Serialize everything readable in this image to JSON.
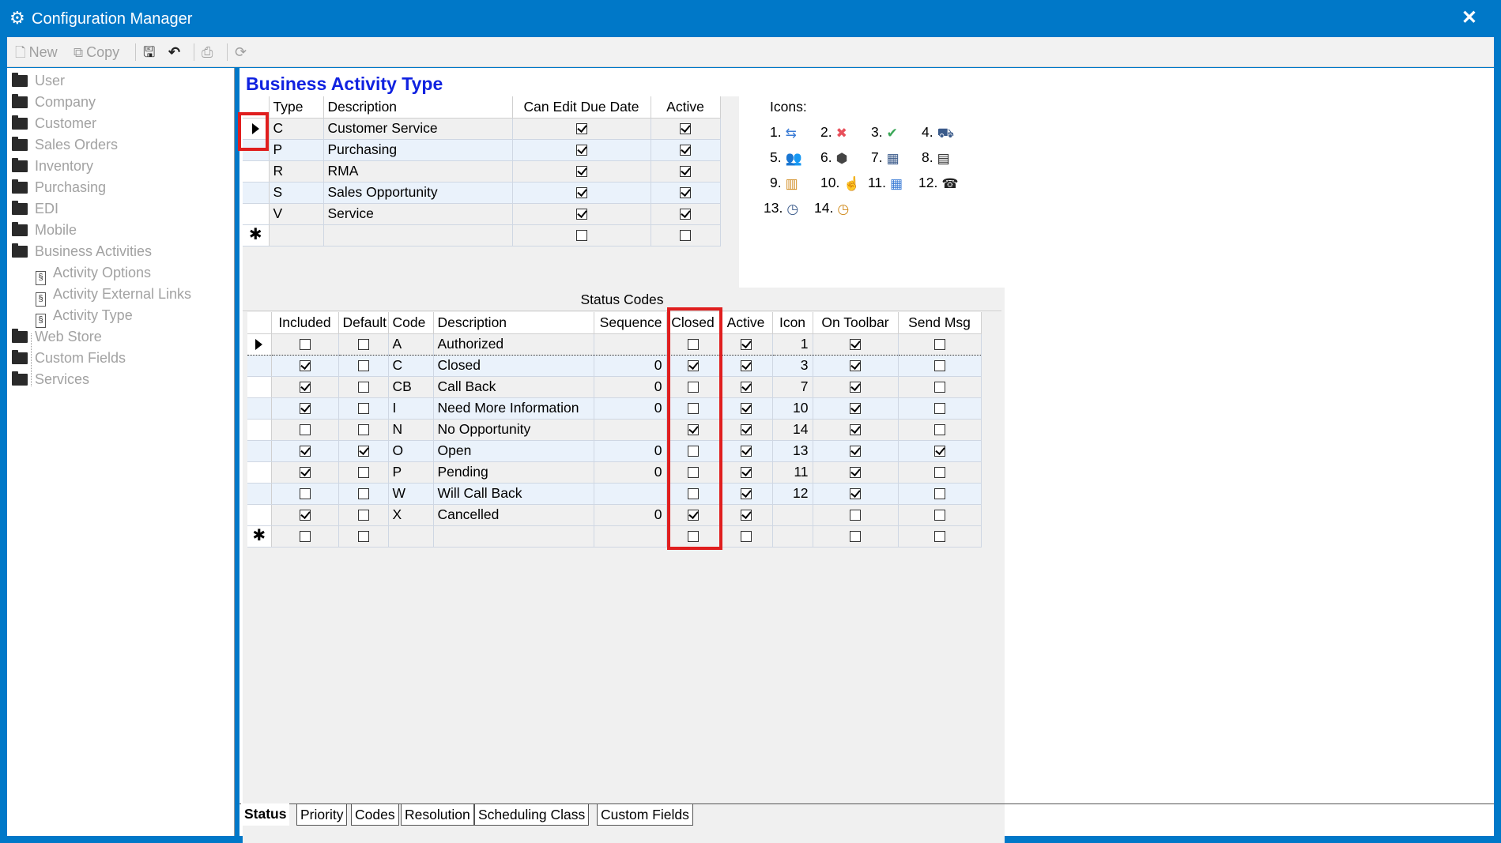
{
  "window": {
    "title": "Configuration Manager",
    "close_glyph": "✕"
  },
  "toolbar": {
    "new_label": "New",
    "copy_label": "Copy"
  },
  "sidebar": {
    "items": [
      "User",
      "Company",
      "Customer",
      "Sales Orders",
      "Inventory",
      "Purchasing",
      "EDI",
      "Mobile",
      "Business Activities"
    ],
    "sub_items": [
      "Activity Options",
      "Activity External Links",
      "Activity Type"
    ],
    "items_after": [
      "Web Store",
      "Custom Fields",
      "Services"
    ]
  },
  "bat": {
    "title": "Business Activity Type",
    "columns": [
      "Type",
      "Description",
      "Can Edit Due Date",
      "Active"
    ],
    "rows": [
      {
        "type": "C",
        "desc": "Customer Service",
        "edit": true,
        "active": true
      },
      {
        "type": "P",
        "desc": "Purchasing",
        "edit": true,
        "active": true
      },
      {
        "type": "R",
        "desc": "RMA",
        "edit": true,
        "active": true
      },
      {
        "type": "S",
        "desc": "Sales Opportunity",
        "edit": true,
        "active": true
      },
      {
        "type": "V",
        "desc": "Service",
        "edit": true,
        "active": true
      }
    ]
  },
  "icons": {
    "title": "Icons:",
    "items": [
      {
        "n": "1.",
        "icon": "people-transfer-icon",
        "glyph": "⇆",
        "color": "#3a7bd5"
      },
      {
        "n": "2.",
        "icon": "red-x-icon",
        "glyph": "✖",
        "color": "#e8505b"
      },
      {
        "n": "3.",
        "icon": "green-check-icon",
        "glyph": "✔",
        "color": "#3aa757"
      },
      {
        "n": "4.",
        "icon": "truck-icon",
        "glyph": "⛟",
        "color": "#3a5a8a"
      },
      {
        "n": "5.",
        "icon": "users-icon",
        "glyph": "👥",
        "color": "#555"
      },
      {
        "n": "6.",
        "icon": "box-icon",
        "glyph": "⬢",
        "color": "#444"
      },
      {
        "n": "7.",
        "icon": "calculator-icon",
        "glyph": "▦",
        "color": "#3a5a8a"
      },
      {
        "n": "8.",
        "icon": "barcode-icon",
        "glyph": "▤",
        "color": "#222"
      },
      {
        "n": "9.",
        "icon": "clipboard-icon",
        "glyph": "▥",
        "color": "#d08a1c"
      },
      {
        "n": "10.",
        "icon": "hand-icon",
        "glyph": "☝",
        "color": "#3a7bd5"
      },
      {
        "n": "11.",
        "icon": "calendar-icon",
        "glyph": "▦",
        "color": "#3a7bd5"
      },
      {
        "n": "12.",
        "icon": "phone-icon",
        "glyph": "☎",
        "color": "#222"
      },
      {
        "n": "13.",
        "icon": "clock-blue-icon",
        "glyph": "◷",
        "color": "#3a5a8a"
      },
      {
        "n": "14.",
        "icon": "clock-orange-icon",
        "glyph": "◷",
        "color": "#d08a1c"
      }
    ]
  },
  "status_codes": {
    "title": "Status Codes",
    "columns": [
      "Included",
      "Default",
      "Code",
      "Description",
      "Sequence",
      "Closed",
      "Active",
      "Icon",
      "On Toolbar",
      "Send Msg"
    ],
    "rows": [
      {
        "inc": false,
        "def": false,
        "code": "A",
        "desc": "Authorized",
        "seq": "",
        "closed": false,
        "active": true,
        "icon": "1",
        "tb": true,
        "msg": false
      },
      {
        "inc": true,
        "def": false,
        "code": "C",
        "desc": "Closed",
        "seq": "0",
        "closed": true,
        "active": true,
        "icon": "3",
        "tb": true,
        "msg": false
      },
      {
        "inc": true,
        "def": false,
        "code": "CB",
        "desc": "Call Back",
        "seq": "0",
        "closed": false,
        "active": true,
        "icon": "7",
        "tb": true,
        "msg": false
      },
      {
        "inc": true,
        "def": false,
        "code": "I",
        "desc": "Need More Information",
        "seq": "0",
        "closed": false,
        "active": true,
        "icon": "10",
        "tb": true,
        "msg": false
      },
      {
        "inc": false,
        "def": false,
        "code": "N",
        "desc": "No Opportunity",
        "seq": "",
        "closed": true,
        "active": true,
        "icon": "14",
        "tb": true,
        "msg": false
      },
      {
        "inc": true,
        "def": true,
        "code": "O",
        "desc": "Open",
        "seq": "0",
        "closed": false,
        "active": true,
        "icon": "13",
        "tb": true,
        "msg": true
      },
      {
        "inc": true,
        "def": false,
        "code": "P",
        "desc": "Pending",
        "seq": "0",
        "closed": false,
        "active": true,
        "icon": "11",
        "tb": true,
        "msg": false
      },
      {
        "inc": false,
        "def": false,
        "code": "W",
        "desc": "Will Call Back",
        "seq": "",
        "closed": false,
        "active": true,
        "icon": "12",
        "tb": true,
        "msg": false
      },
      {
        "inc": true,
        "def": false,
        "code": "X",
        "desc": "Cancelled",
        "seq": "0",
        "closed": true,
        "active": true,
        "icon": "",
        "tb": false,
        "msg": false
      }
    ]
  },
  "tabs": [
    "Status",
    "Priority",
    "Codes",
    "Resolution",
    "Scheduling Class",
    "Custom Fields"
  ],
  "colors": {
    "accent": "#0078c8",
    "title_blue": "#1022e0",
    "highlight_red": "#e01e1e",
    "alt_row": "#eaf2fb"
  }
}
